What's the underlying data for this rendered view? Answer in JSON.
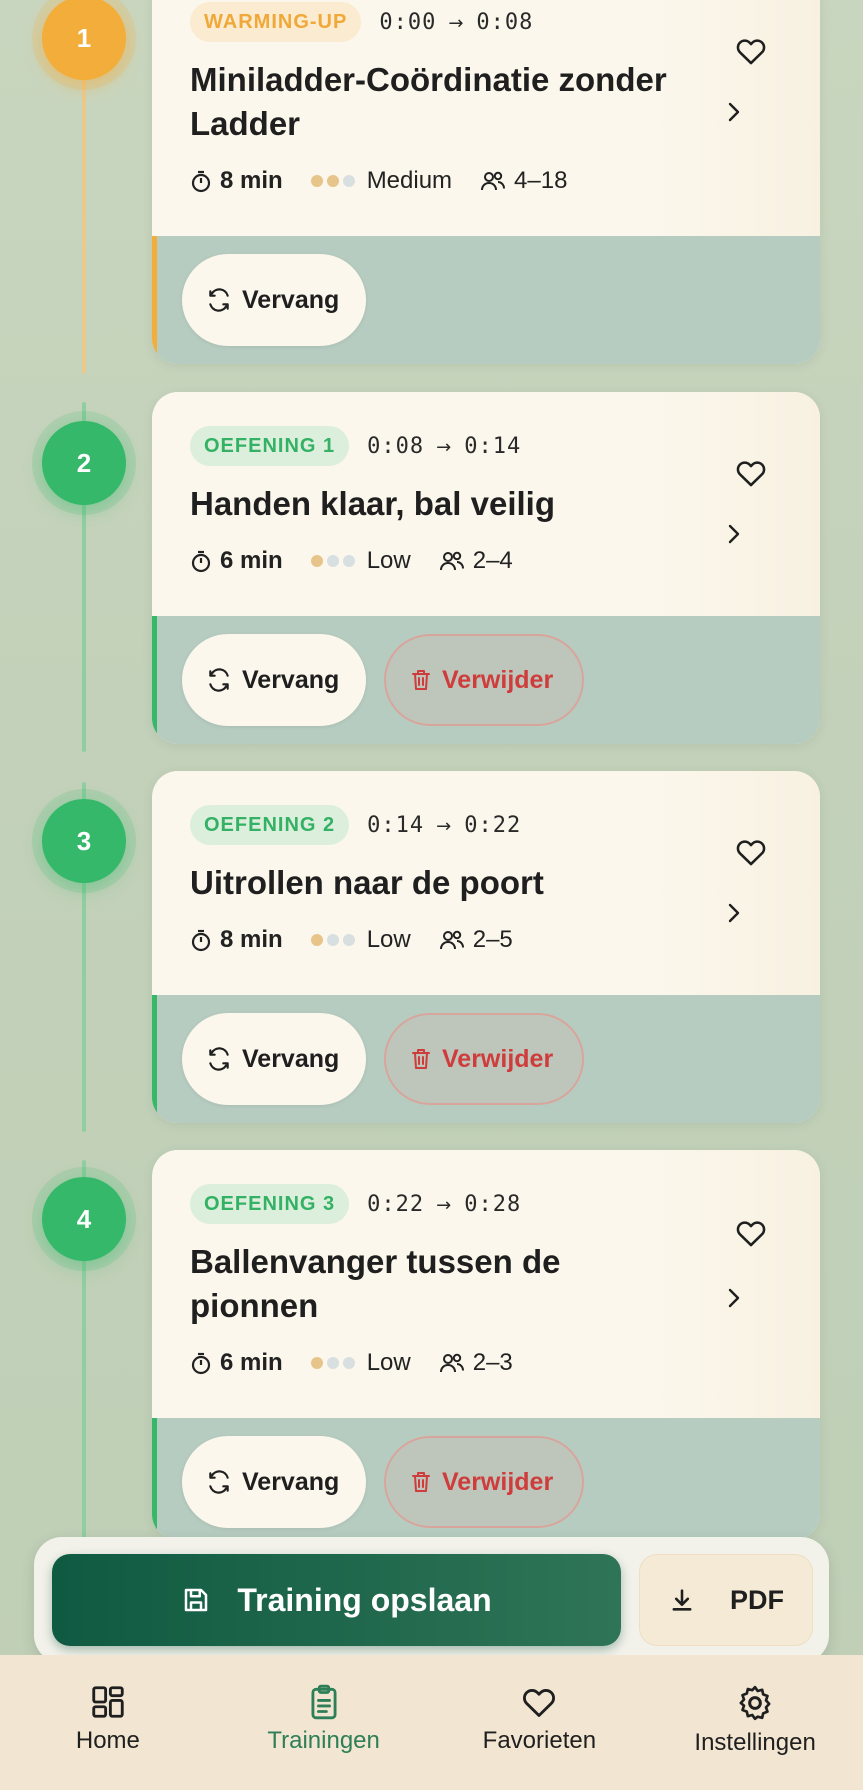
{
  "colors": {
    "warmup": "#f3ad3b",
    "exercise": "#35b86a",
    "delete": "#cf3c3c",
    "primary": "#0f5a42",
    "nav_active": "#2e7f57"
  },
  "cards": [
    {
      "step": "1",
      "kind": "orange",
      "tag": "WARMING-UP",
      "start": "0:00",
      "end": "0:08",
      "title": "Miniladder-Coördinatie zonder Ladder",
      "duration": "8 min",
      "intensity_level": 2,
      "intensity": "Medium",
      "players": "4–18",
      "replace": "Vervang",
      "delete": null
    },
    {
      "step": "2",
      "kind": "green",
      "tag": "OEFENING 1",
      "start": "0:08",
      "end": "0:14",
      "title": "Handen klaar, bal veilig",
      "duration": "6 min",
      "intensity_level": 1,
      "intensity": "Low",
      "players": "2–4",
      "replace": "Vervang",
      "delete": "Verwijder"
    },
    {
      "step": "3",
      "kind": "green",
      "tag": "OEFENING 2",
      "start": "0:14",
      "end": "0:22",
      "title": "Uitrollen naar de poort",
      "duration": "8 min",
      "intensity_level": 1,
      "intensity": "Low",
      "players": "2–5",
      "replace": "Vervang",
      "delete": "Verwijder"
    },
    {
      "step": "4",
      "kind": "green",
      "tag": "OEFENING 3",
      "start": "0:22",
      "end": "0:28",
      "title": "Ballenvanger tussen de pionnen",
      "duration": "6 min",
      "intensity_level": 1,
      "intensity": "Low",
      "players": "2–3",
      "replace": "Vervang",
      "delete": "Verwijder"
    }
  ],
  "actions": {
    "save_label": "Training opslaan",
    "pdf_label": "PDF"
  },
  "nav": [
    {
      "label": "Home",
      "icon": "grid-icon",
      "active": false
    },
    {
      "label": "Trainingen",
      "icon": "clipboard-icon",
      "active": true
    },
    {
      "label": "Favorieten",
      "icon": "heart-icon",
      "active": false
    },
    {
      "label": "Instellingen",
      "icon": "gear-icon",
      "active": false
    }
  ]
}
